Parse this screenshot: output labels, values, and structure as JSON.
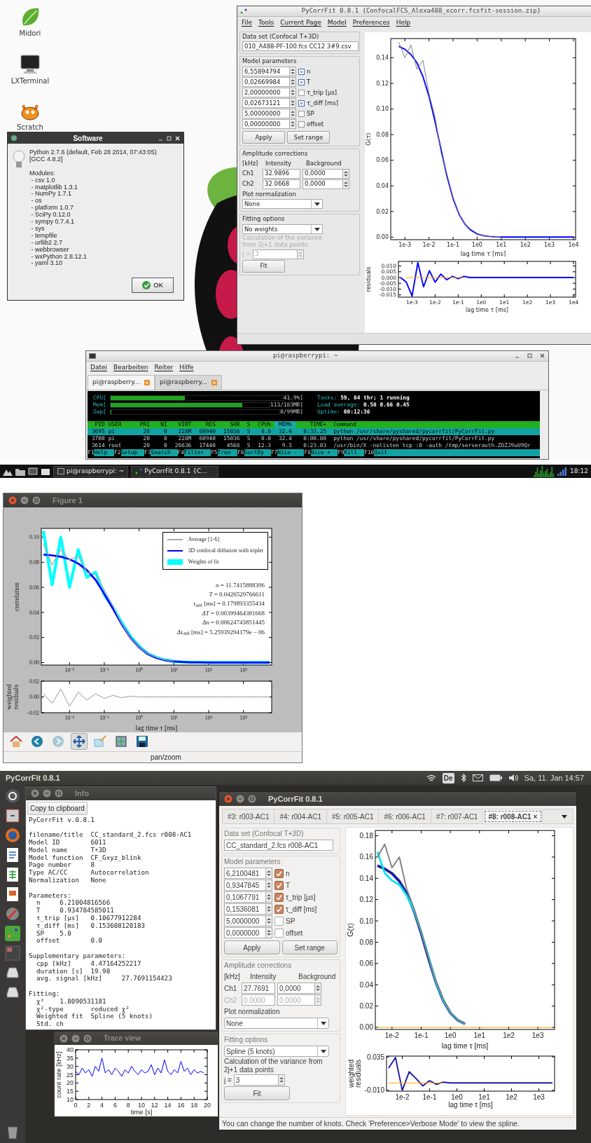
{
  "raspberry_desktop": {
    "desktop_icons": [
      {
        "label": "Midori",
        "kind": "browser"
      },
      {
        "label": "LXTerminal",
        "kind": "terminal"
      },
      {
        "label": "Scratch",
        "kind": "cat"
      }
    ],
    "software_dialog": {
      "title": "Software",
      "version_lines": [
        "Python 2.7.6 (default, Feb 28 2014, 07:43:05)",
        "[GCC 4.8.2]"
      ],
      "modules_heading": "Modules:",
      "modules": [
        " - csv 1.0",
        " - matplotlib 1.3.1",
        " - NumPy 1.7.1",
        " - os",
        " - platform 1.0.7",
        " - SciPy 0.12.0",
        " - sympy 0.7.4.1",
        " - sys",
        " - tempfile",
        " - urllib2 2.7",
        " - webbrowser",
        " - wxPython 2.8.12.1",
        " - yaml 3.10"
      ],
      "ok_button": "OK"
    },
    "pycorrfit_window": {
      "title": "PyCorrFit 0.8.1 {ConfocalFCS_Alexa488_xcorr.fcsfit-session.zip}",
      "menu": [
        "File",
        "Tools",
        "Current Page",
        "Model",
        "Preferences",
        "Help"
      ],
      "data_set": {
        "legend": "Data set (Confocal T+3D)",
        "value": "010_A488-PF-100.fcs CC12 3#9.csv"
      },
      "model_parameters": {
        "legend": "Model parameters",
        "params": [
          {
            "value": "6,55894794",
            "label": "n",
            "checked": true
          },
          {
            "value": "0,02669984",
            "label": "T",
            "checked": true
          },
          {
            "value": "2,00000000",
            "label": "τ_trip [μs]",
            "checked": false
          },
          {
            "value": "0,02673121",
            "label": "τ_diff [ms]",
            "checked": true
          },
          {
            "value": "5,00000000",
            "label": "SP",
            "checked": false
          },
          {
            "value": "0,00000000",
            "label": "offset",
            "checked": false
          }
        ],
        "buttons": [
          "Apply",
          "Set range"
        ]
      },
      "amplitude": {
        "legend": "Amplitude corrections",
        "headers": [
          "[kHz]",
          "Intensity",
          "Background"
        ],
        "channels": [
          {
            "label": "Ch1",
            "intensity": "32.9896",
            "background": "0,0000",
            "disabled": false
          },
          {
            "label": "Ch2",
            "intensity": "32.0668",
            "background": "0,0000",
            "disabled": false
          }
        ],
        "normalization_label": "Plot normalization",
        "normalization": "None"
      },
      "fitting": {
        "legend": "Fitting options",
        "value": "No weights",
        "variance": {
          "note": "Calculation of the variance from 2j+1 data points",
          "j_label": "j =",
          "j_value": "3",
          "disabled": true
        },
        "fit_button": "Fit"
      },
      "plot": {
        "chart_data": {
          "type": "line",
          "xlabel": "lag time τ [ms]",
          "ylabel": "G(τ)",
          "categories": [
            null,
            null,
            "1e-3",
            null,
            null,
            null,
            "1e-2",
            null,
            null,
            null,
            "1e-1",
            null,
            null,
            null,
            "1e0",
            null,
            null,
            null,
            "1e1",
            null,
            null,
            null,
            "1e2",
            null,
            null,
            null,
            "1e3",
            null,
            null,
            null,
            "1e4"
          ],
          "series": [
            {
              "color": "#808080",
              "values": [
                null,
                0.152,
                0.14,
                0.15,
                0.131,
                0.138,
                0.112,
                0.094,
                0.066,
                0.049,
                0.031,
                0.018,
                0.01,
                0.006,
                0.003,
                0.001,
                0.0005,
                0,
                0,
                null,
                null,
                null,
                null,
                null,
                null,
                null,
                null,
                null,
                null,
                null,
                null
              ]
            },
            {
              "color": "#0000ff",
              "values": [
                null,
                0.1489,
                0.1466,
                0.1426,
                0.1361,
                0.1253,
                0.1101,
                0.0904,
                0.0684,
                0.0474,
                0.0302,
                0.0178,
                0.0099,
                0.0052,
                0.0025,
                0.0012,
                0.0005,
                0.0002,
                0.0001,
                0,
                0,
                0,
                0,
                0,
                0,
                0,
                0,
                0,
                0,
                0,
                0
              ]
            }
          ],
          "ylim": [
            -0.002,
            0.155
          ],
          "yticks": [
            {
              "value": 0,
              "label": "0.00"
            },
            {
              "value": 0.02,
              "label": "0.02"
            },
            {
              "value": 0.04,
              "label": "0.04"
            },
            {
              "value": 0.06,
              "label": "0.06"
            },
            {
              "value": 0.08,
              "label": "0.08"
            },
            {
              "value": 0.1,
              "label": "0.10"
            },
            {
              "value": 0.12,
              "label": "0.12"
            },
            {
              "value": 0.14,
              "label": "0.14"
            }
          ]
        }
      },
      "residuals": {
        "chart_data": {
          "type": "line",
          "xlabel": "lag time τ [ms]",
          "ylabel": "residuals",
          "categories": [
            null,
            null,
            "1e-3",
            null,
            null,
            null,
            "1e-2",
            null,
            null,
            null,
            "1e-1",
            null,
            null,
            null,
            "1e0",
            null,
            null,
            null,
            "1e1",
            null,
            null,
            null,
            "1e2",
            null,
            null,
            null,
            "1e3",
            null,
            null,
            null,
            "1e4"
          ],
          "series": [
            {
              "color": "#ffa500",
              "values": [
                null,
                0,
                0,
                0,
                0,
                0,
                0,
                0,
                0,
                0,
                0,
                0,
                null,
                null,
                null,
                null,
                null,
                null,
                null,
                null,
                null,
                null,
                null,
                null,
                null,
                null,
                null,
                null,
                null,
                null,
                null
              ]
            },
            {
              "color": "#0000ff",
              "values": [
                0,
                -0.004,
                -0.016,
                0.013,
                -0.008,
                0.006,
                -0.004,
                0.003,
                -0.002,
                0.001,
                -0.001,
                0.001,
                0,
                0,
                0,
                0,
                0,
                0,
                0,
                0,
                0,
                0,
                0,
                0,
                0,
                0,
                0,
                0,
                0,
                0,
                0
              ]
            }
          ],
          "ylim": [
            -0.017,
            0.014
          ],
          "yticks": [
            {
              "value": 0.01,
              "label": "0.010"
            },
            {
              "value": 0.005,
              "label": "0.005"
            },
            {
              "value": 0,
              "label": "0.000"
            },
            {
              "value": -0.005,
              "label": "-0.005"
            },
            {
              "value": -0.01,
              "label": "-0.010"
            },
            {
              "value": -0.015,
              "label": "-0.015"
            }
          ]
        }
      }
    },
    "terminal": {
      "title": "pi@raspberrypi: ~",
      "menu": [
        "Datei",
        "Bearbeiten",
        "Reiter",
        "Hilfe"
      ],
      "tabs": [
        {
          "label": "pi@raspberry...",
          "selected": true
        },
        {
          "label": "pi@raspberry...",
          "selected": false
        }
      ],
      "meters": [
        {
          "label": "CPU[",
          "level": 0.43,
          "reading": "41.9%]"
        },
        {
          "label": "Mem[",
          "level": 0.83,
          "reading": "113/183MB]"
        },
        {
          "label": "Swp[",
          "level": 0,
          "reading": "0/99MB]"
        }
      ],
      "info_lines": [
        {
          "label": "Tasks:",
          "value": "59, 84 thr; 1 running"
        },
        {
          "label": "Load average:",
          "value": "0.58 0.66 0.45"
        },
        {
          "label": "Uptime:",
          "value": "00:12:36"
        }
      ],
      "columns": [
        {
          "label": "PID",
          "sorted": false
        },
        {
          "label": "USER",
          "sorted": false
        },
        {
          "label": "PRI",
          "sorted": false
        },
        {
          "label": "NI",
          "sorted": false
        },
        {
          "label": "VIRT",
          "sorted": false
        },
        {
          "label": "RES",
          "sorted": false
        },
        {
          "label": "SHR",
          "sorted": false
        },
        {
          "label": "S",
          "sorted": false
        },
        {
          "label": "CPU%",
          "sorted": false
        },
        {
          "label": "MEM%",
          "sorted": true
        },
        {
          "label": "TIME+",
          "sorted": false
        },
        {
          "label": "Command",
          "sorted": false
        }
      ],
      "rows": [
        {
          "selected": true,
          "cells": [
            "3695",
            "pi",
            "20",
            "0",
            "228M",
            "60940",
            "15036",
            "S",
            "0.0",
            "32.4",
            "0:33.25",
            "python /usr/share/pyshared/pycorrfit/PyCorrFit.py"
          ]
        },
        {
          "selected": false,
          "cells": [
            "3700",
            "pi",
            "20",
            "0",
            "228M",
            "60940",
            "15036",
            "S",
            "0.0",
            "32.4",
            "0:00.00",
            "python /usr/share/pyshared/pycorrfit/PyCorrFit.py"
          ]
        },
        {
          "selected": false,
          "cells": [
            "3614",
            "root",
            "20",
            "0",
            "26636",
            "17440",
            "4568",
            "S",
            "12.3",
            "9.3",
            "0:23.03",
            "/usr/bin/X -nolisten tcp :0 -auth /tmp/serverauth.ZOZJ9uU9Qr"
          ]
        }
      ],
      "function_keys": [
        {
          "key": "F1",
          "label": "Help"
        },
        {
          "key": "F2",
          "label": "Setup"
        },
        {
          "key": "F3",
          "label": "Search"
        },
        {
          "key": "F4",
          "label": "Filter"
        },
        {
          "key": "F5",
          "label": "Tree"
        },
        {
          "key": "F6",
          "label": "SortBy"
        },
        {
          "key": "F7",
          "label": "Nice -"
        },
        {
          "key": "F8",
          "label": "Nice +"
        },
        {
          "key": "F9",
          "label": "Kill"
        },
        {
          "key": "F10",
          "label": "Quit"
        }
      ]
    },
    "taskbar": {
      "tasks": [
        {
          "label": "pi@raspberrypi: ~",
          "kind": "terminal"
        },
        {
          "label": "PyCorrFit 0.8.1 {C...",
          "kind": "app"
        }
      ],
      "clock": "18:12"
    }
  },
  "figure_window": {
    "title": "Figure 1",
    "plot": {
      "chart_data": {
        "type": "line",
        "ylabel": "correlation",
        "legend": "upper right",
        "categories": [
          null,
          null,
          null,
          "10⁻²",
          null,
          null,
          null,
          "10⁻¹",
          null,
          null,
          null,
          "10⁰",
          null,
          null,
          null,
          "10¹",
          null,
          null,
          null,
          "10²",
          null,
          null,
          null,
          "10³",
          null,
          null,
          null
        ],
        "series": [
          {
            "name": "Average [1-6]",
            "color": "#aaaaaa",
            "values": [
              0.095,
              0.078,
              0.09,
              0.082,
              0.085,
              0.072,
              0.07,
              0.058,
              0.045,
              0.031,
              0.02,
              0.012,
              0.007,
              0.004,
              0.002,
              0.001,
              null,
              null,
              null,
              null,
              null,
              null,
              null,
              null,
              null,
              null,
              null
            ]
          },
          {
            "name": "3D confocal diffusion with triplet",
            "color": "#0000ff",
            "values": [
              0.0861,
              0.0855,
              0.0844,
              0.0824,
              0.079,
              0.0737,
              0.0659,
              0.0547,
              0.0429,
              0.0305,
              0.0199,
              0.012,
              0.0068,
              0.0036,
              0.0018,
              0.0009,
              0.0004,
              0.0002,
              0.0001,
              0,
              0,
              0,
              0,
              0,
              0,
              0,
              0
            ]
          },
          {
            "name": "Weights of fit",
            "color": "#00ffff",
            "values": [
              0.105,
              0.062,
              0.1,
              0.06,
              0.09,
              0.068,
              0.072,
              0.054,
              0.044,
              0.032,
              0.021,
              0.013,
              0.007,
              0.004,
              0.002,
              0.001,
              0.0004,
              0.0002,
              0.0001,
              0,
              0,
              0,
              0,
              0,
              0,
              0,
              0
            ]
          }
        ],
        "ylim": [
          -0.002,
          0.107
        ],
        "yticks": [
          {
            "value": 0,
            "label": "0.00"
          },
          {
            "value": 0.02,
            "label": "0.02"
          },
          {
            "value": 0.04,
            "label": "0.04"
          },
          {
            "value": 0.06,
            "label": "0.06"
          },
          {
            "value": 0.08,
            "label": "0.08"
          },
          {
            "value": 0.1,
            "label": "0.10"
          }
        ],
        "annotations": [
          "*n* = 11.7415888396",
          "*T* = 0.0426529766611",
          "*τ*$_{diff}$ [ms] = 0.179893355434",
          "*ΔT* = 0.00399464381668",
          "*Δn* = 0.00624743851445",
          "*Δτ*$_{diff}$ [ms] = 5.25939294179e − 06"
        ]
      }
    },
    "residuals": {
      "chart_data": {
        "type": "line",
        "xlabel": "lag time τ [ms]",
        "ylabel": "weighted residuals",
        "categories": [
          null,
          null,
          null,
          "10⁻²",
          null,
          null,
          null,
          "10⁻¹",
          null,
          null,
          null,
          "10⁰",
          null,
          null,
          null,
          "10¹",
          null,
          null,
          null,
          "10²",
          null,
          null,
          null,
          "10³",
          null,
          null,
          null
        ],
        "series": [
          {
            "color": "#999999",
            "values": [
              0.004,
              -0.008,
              0.01,
              -0.012,
              0.006,
              -0.004,
              0.004,
              -0.002,
              0.002,
              -0.001,
              0.001,
              0,
              0,
              0,
              0,
              0,
              0,
              0,
              0,
              0,
              0,
              0,
              0,
              0,
              0,
              0,
              0
            ]
          }
        ],
        "ylim": [
          -0.02,
          0.02
        ],
        "yticks": [
          {
            "value": -0.02,
            "label": "−0.02"
          },
          {
            "value": 0,
            "label": "0.00"
          },
          {
            "value": 0.02,
            "label": "0.02"
          }
        ]
      }
    },
    "toolbar": [
      {
        "kind": "home",
        "selected": false,
        "disabled": false
      },
      {
        "kind": "back",
        "selected": false,
        "disabled": false
      },
      {
        "kind": "forward",
        "selected": false,
        "disabled": true
      },
      {
        "kind": "pan",
        "selected": true,
        "disabled": false
      },
      {
        "kind": "zoom",
        "selected": false,
        "disabled": false
      },
      {
        "kind": "subplots",
        "selected": false,
        "disabled": false
      },
      {
        "kind": "save",
        "selected": false,
        "disabled": false
      }
    ],
    "status": "pan/zoom"
  },
  "ubuntu_desktop": {
    "top_bar": {
      "app_title": "PyCorrFit 0.8.1",
      "keyboard": "De",
      "clock": "Sa, 11. Jan 14:57"
    },
    "info_window": {
      "title": "Info",
      "copy_button": "Copy to clipboard",
      "blocks": [
        [
          "PyCorrFit v.0.8.1"
        ],
        [
          "filename/title  CC_standard_2.fcs r008-AC1",
          "Model ID        6011",
          "Model name      T+3D",
          "Model function  CF_Gxyz_blink",
          "Page number     8",
          "Type AC/CC      Autocorrelation",
          "Normalization   None"
        ],
        [
          "Parameters:",
          "  n     6.21004816566",
          "  T     0.934784585011",
          "  τ_trip [μs]   0.10677912284",
          "  τ_diff [ms]   0.153608120183",
          "  SP    5.0",
          "  offset        0.0"
        ],
        [
          "Supplementary parameters:",
          "  cpp [kHz]     4.47164252217",
          "  duration [s]  19.98",
          "  avg. signal [kHz]     27.7691154423"
        ],
        [
          "Fitting:",
          "  χ²    1.8090531181",
          "  χ²-type       reduced χ²",
          "  Weighted fit  Spline (5 knots)",
          "  Std. ch"
        ]
      ]
    },
    "trace_window": {
      "title": "Trace view",
      "chart_data": {
        "type": "line",
        "xlabel": "time [s]",
        "ylabel": "count rate [kHz]",
        "x": [
          0,
          0.5,
          1,
          1.5,
          2,
          2.5,
          3,
          3.5,
          4,
          4.5,
          5,
          5.5,
          6,
          6.5,
          7,
          7.5,
          8,
          8.5,
          9,
          9.5,
          10,
          10.5,
          11,
          11.5,
          12,
          12.5,
          13,
          13.5,
          14,
          14.5,
          15,
          15.5,
          16,
          16.5,
          17,
          17.5,
          18,
          18.5,
          19,
          19.5
        ],
        "series": [
          {
            "color": "#0000ff",
            "values": [
              27,
              25,
              29,
              26,
              28,
              24,
              30,
              27,
              35,
              26,
              28,
              25,
              29,
              27,
              24,
              28,
              26,
              30,
              27,
              25,
              28,
              26,
              27,
              31,
              25,
              29,
              26,
              34,
              27,
              25,
              28,
              26,
              33,
              27,
              29,
              25,
              28,
              26,
              27,
              26
            ]
          }
        ],
        "xlim": [
          0,
          20
        ],
        "ylim": [
          10,
          40
        ],
        "xticks": [
          0,
          2,
          4,
          6,
          8,
          10,
          12,
          14,
          16,
          18,
          20
        ],
        "yticks": [
          10,
          15,
          20,
          25,
          30,
          35,
          40
        ]
      }
    },
    "pycorrfit_window": {
      "title": "PyCorrFit 0.8.1",
      "tabs": [
        {
          "label": "#3: r003-AC1",
          "selected": false
        },
        {
          "label": "#4: r004-AC1",
          "selected": false
        },
        {
          "label": "#5: r005-AC1",
          "selected": false
        },
        {
          "label": "#6: r006-AC1",
          "selected": false
        },
        {
          "label": "#7: r007-AC1",
          "selected": false
        },
        {
          "label": "#8: r008-AC1",
          "selected": true,
          "close": "×"
        }
      ],
      "data_set": {
        "legend": "Data set (Confocal T+3D)",
        "value": "CC_standard_2.fcs r008-AC1"
      },
      "model_parameters": {
        "legend": "Model parameters",
        "params": [
          {
            "value": "6,2100481",
            "label": "n",
            "checked": true
          },
          {
            "value": "0,9347845",
            "label": "T",
            "checked": true
          },
          {
            "value": "0,1067791",
            "label": "τ_trip [μs]",
            "checked": true
          },
          {
            "value": "0,1536081",
            "label": "τ_diff [ms]",
            "checked": true
          },
          {
            "value": "5,0000000",
            "label": "SP",
            "checked": false
          },
          {
            "value": "0,0000000",
            "label": "offset",
            "checked": false
          }
        ],
        "buttons": [
          "Apply",
          "Set range"
        ]
      },
      "amplitude": {
        "legend": "Amplitude corrections",
        "headers": [
          "[kHz]",
          "Intensity",
          "Background"
        ],
        "channels": [
          {
            "label": "Ch1",
            "intensity": "27.7691",
            "background": "0,0000",
            "disabled": false
          },
          {
            "label": "Ch2",
            "intensity": "0.0000",
            "background": "0,0000",
            "disabled": true
          }
        ],
        "normalization_label": "Plot normalization",
        "normalization": "None"
      },
      "fitting": {
        "legend": "Fitting options",
        "value": "Spline (5 knots)",
        "variance": {
          "note": "Calculation of the variance from 2j+1 data points",
          "j_label": "j =",
          "j_value": "3",
          "disabled": false
        },
        "fit_button": "Fit"
      },
      "plot": {
        "chart_data": {
          "type": "line",
          "xlabel": "lag time τ [ms]",
          "ylabel": "G(τ)",
          "categories": [
            null,
            null,
            "1e-2",
            null,
            null,
            null,
            "1e-1",
            null,
            null,
            null,
            "1e0",
            null,
            null,
            null,
            "1e1",
            null,
            null,
            null,
            "1e2",
            null,
            null,
            null,
            "1e3",
            null,
            null
          ],
          "series": [
            {
              "color": "#ffa500",
              "values": [
                0,
                0,
                0,
                0,
                0,
                0,
                0,
                0,
                0,
                0,
                0,
                0,
                0,
                0,
                0,
                0,
                0,
                0,
                0,
                0,
                0,
                0,
                0,
                0,
                0
              ]
            },
            {
              "color": "#808080",
              "values": [
                0.16,
                0.172,
                0.15,
                0.16,
                0.13,
                0.112,
                0.09,
                0.066,
                0.044,
                0.027,
                0.014,
                0.007,
                0.003,
                null,
                null,
                null,
                null,
                null,
                null,
                null,
                null,
                null,
                null,
                null,
                null
              ]
            },
            {
              "color": "#00e5ee",
              "values": [
                0.165,
                0.145,
                0.138,
                0.134,
                0.124,
                0.11,
                0.09,
                0.067,
                0.043,
                0.026,
                0.014,
                0.007,
                0.003,
                null,
                null,
                null,
                null,
                null,
                null,
                null,
                null,
                null,
                null,
                null,
                null
              ]
            },
            {
              "color": "#1a1aa6",
              "values": [
                0.1519,
                0.149,
                0.1446,
                0.1373,
                0.126,
                0.1095,
                0.0883,
                0.0647,
                0.0426,
                0.0253,
                0.0136,
                0.0068,
                0.0032,
                null,
                null,
                null,
                null,
                null,
                null,
                null,
                null,
                null,
                null,
                null,
                null
              ]
            }
          ],
          "ylim": [
            -0.002,
            0.185
          ],
          "yticks": [
            {
              "value": 0,
              "label": "0.00"
            },
            {
              "value": 0.02,
              "label": "0.02"
            },
            {
              "value": 0.04,
              "label": "0.04"
            },
            {
              "value": 0.06,
              "label": "0.06"
            },
            {
              "value": 0.08,
              "label": "0.08"
            },
            {
              "value": 0.1,
              "label": "0.10"
            },
            {
              "value": 0.12,
              "label": "0.12"
            },
            {
              "value": 0.14,
              "label": "0.14"
            },
            {
              "value": 0.16,
              "label": "0.16"
            },
            {
              "value": 0.18,
              "label": "0.18"
            }
          ]
        }
      },
      "residuals": {
        "chart_data": {
          "type": "line",
          "xlabel": "lag time τ [ms]",
          "ylabel": "weighted residuals",
          "categories": [
            null,
            null,
            "1e-2",
            null,
            null,
            null,
            "1e-1",
            null,
            null,
            null,
            "1e0",
            null,
            null,
            null,
            "1e1",
            null,
            null,
            null,
            "1e2",
            null,
            null,
            null,
            "1e3",
            null,
            null
          ],
          "series": [
            {
              "color": "#ffa500",
              "values": [
                0,
                0,
                0,
                0,
                0,
                0,
                0,
                0,
                0,
                null,
                null,
                null,
                null,
                null,
                null,
                null,
                null,
                null,
                null,
                null,
                null,
                null,
                null,
                null,
                null
              ]
            },
            {
              "color": "#1a1aa6",
              "values": [
                0.02,
                0.034,
                -0.01,
                0.015,
                0.006,
                -0.004,
                0.003,
                -0.002,
                0.001,
                0,
                0,
                0,
                0,
                0,
                0,
                0,
                0,
                0,
                0,
                0,
                0,
                0,
                0,
                0,
                0
              ]
            }
          ],
          "ylim": [
            -0.011,
            0.036
          ],
          "yticks": [
            {
              "value": -0.01,
              "label": "-0.010"
            },
            {
              "value": 0.035,
              "label": "0.035"
            }
          ]
        }
      },
      "status_bar": "You can change the number of knots. Check 'Preference>Verbose Mode' to view the spline."
    }
  }
}
